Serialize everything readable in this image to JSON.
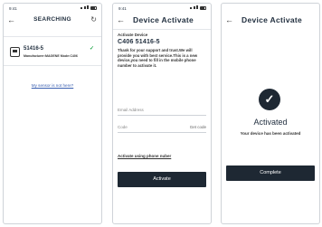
{
  "screen1": {
    "time": "9:41",
    "title": "SEARCHING",
    "device": {
      "name": "51416-5",
      "meta": "Manufacturer:MAGENE  Mode:C406"
    },
    "help_link": "My sensor is not here?"
  },
  "screen2": {
    "time": "9:41",
    "title": "Device Activate",
    "label": "Activate Device",
    "code": "C406 51416-5",
    "message": "Thank for your support and trust.We will provide you with best service.This is a new device,you need to fill in the mobile phone number to activate it.",
    "email_placeholder": "Email Address",
    "code_placeholder": "Code",
    "get_code": "Get code",
    "phone_link": "Activate using phone nuber",
    "button": "Activate"
  },
  "screen3": {
    "title": "Device Activate",
    "status": "Activated",
    "message": "Your device has been activated",
    "button": "Complete"
  },
  "colors": {
    "primary_button": "#1e2833",
    "link": "#3a5fb0",
    "success": "#22a64a"
  }
}
